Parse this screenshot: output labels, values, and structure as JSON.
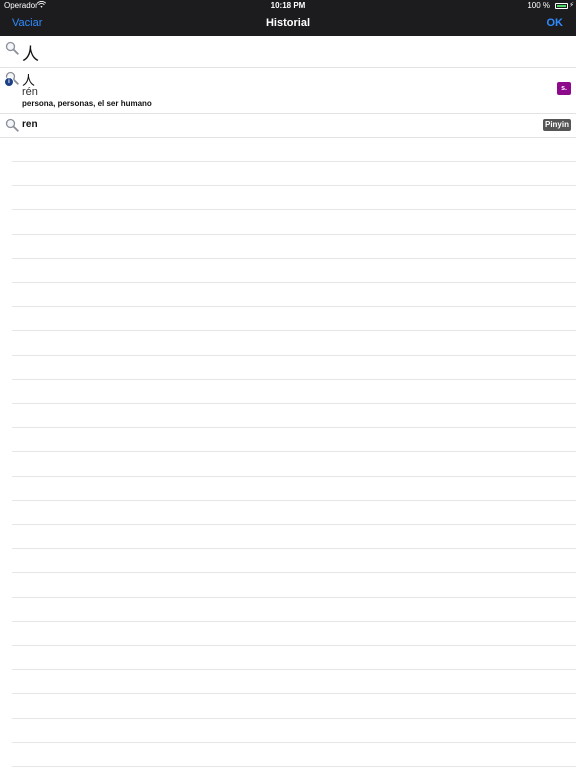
{
  "status_bar": {
    "carrier": "Operador",
    "time": "10:18 PM",
    "battery": "100 %"
  },
  "nav": {
    "left_button": "Vaciar",
    "title": "Historial",
    "right_button": "OK"
  },
  "history": [
    {
      "query": "人",
      "icon": "search-icon"
    },
    {
      "hanzi": "人",
      "pinyin": "rén",
      "meaning": "persona, personas, el ser humano",
      "tag": "s.",
      "icon": "search-icon",
      "badge_icon": "info-icon"
    },
    {
      "query": "ren",
      "tag": "Pinyin",
      "icon": "search-icon"
    }
  ],
  "colors": {
    "bar_background": "#1c1c1e",
    "accent": "#2f8cff",
    "tag_purple": "#8e0a8c",
    "tag_gray": "#555555"
  }
}
